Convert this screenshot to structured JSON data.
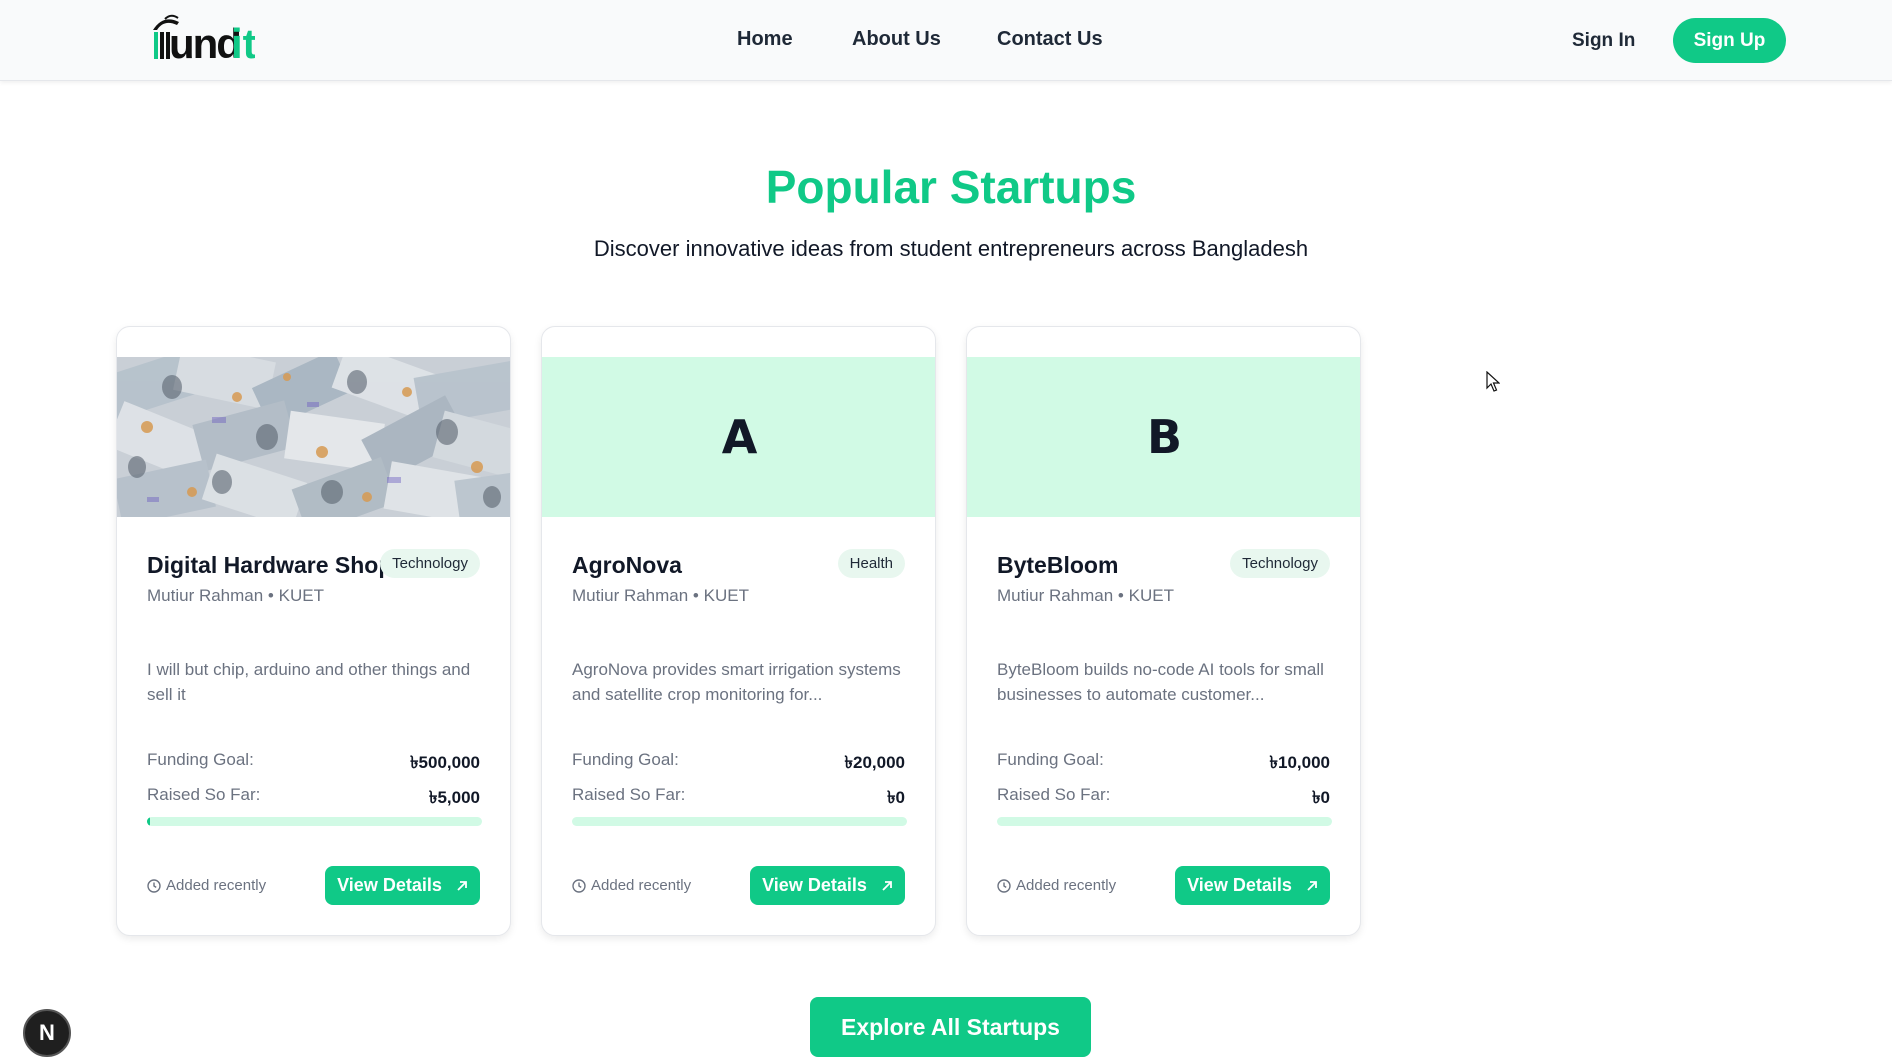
{
  "brand": {
    "logo_text": "fundit",
    "accent": "#10c987"
  },
  "nav": {
    "links": [
      "Home",
      "About Us",
      "Contact Us"
    ],
    "signin": "Sign In",
    "signup": "Sign Up"
  },
  "hero": {
    "title": "Popular Startups",
    "subtitle": "Discover innovative ideas from student entrepreneurs across Bangladesh"
  },
  "cards": [
    {
      "media": "money-photo",
      "title": "Digital Hardware Shop",
      "category": "Technology",
      "author": "Mutiur Rahman • KUET",
      "description": "I will but chip, arduino and other things and sell it",
      "goal_label": "Funding Goal:",
      "goal_value": "৳500,000",
      "raised_label": "Raised So Far:",
      "raised_value": "৳5,000",
      "progress": 0.01,
      "added": "Added recently",
      "button": "View Details"
    },
    {
      "media_letter": "A",
      "title": "AgroNova",
      "category": "Health",
      "author": "Mutiur Rahman • KUET",
      "description": "AgroNova provides smart irrigation systems and satellite crop monitoring for...",
      "goal_label": "Funding Goal:",
      "goal_value": "৳20,000",
      "raised_label": "Raised So Far:",
      "raised_value": "৳0",
      "progress": 0,
      "added": "Added recently",
      "button": "View Details"
    },
    {
      "media_letter": "B",
      "title": "ByteBloom",
      "category": "Technology",
      "author": "Mutiur Rahman • KUET",
      "description": "ByteBloom builds no-code AI tools for small businesses to automate customer...",
      "goal_label": "Funding Goal:",
      "goal_value": "৳10,000",
      "raised_label": "Raised So Far:",
      "raised_value": "৳0",
      "progress": 0,
      "added": "Added recently",
      "button": "View Details"
    }
  ],
  "explore_button": "Explore All Startups",
  "dev_badge": "N"
}
